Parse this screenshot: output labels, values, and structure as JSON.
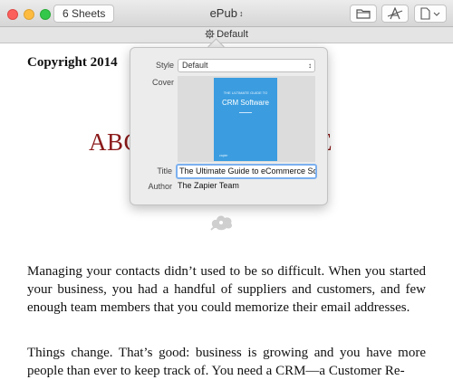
{
  "toolbar": {
    "sheets_label": "6 Sheets",
    "doc_title": "ePub",
    "title_chevron": "⌃⌄"
  },
  "sheetbar": {
    "label": "Default"
  },
  "document": {
    "copyright": "Copyright 2014",
    "chapter_left": "ABC",
    "chapter_right": "DE",
    "paragraph1": "Managing your contacts didn’t used to be so difficult. When you started your business, you had a handful of suppliers and customers, and few enough team members that you could memorize their email addresses.",
    "paragraph2": "Things change. That’s good: business is growing and you have more people than ever to keep track of. You need a CRM—a Customer Re-"
  },
  "popover": {
    "style_label": "Style",
    "style_value": "Default",
    "cover_label": "Cover",
    "title_label": "Title",
    "title_value": "The Ultimate Guide to eCommerce Software",
    "author_label": "Author",
    "author_value": "The Zapier Team",
    "cover_art": {
      "top_text": "THE ULTIMATE GUIDE TO",
      "main_text": "CRM Software",
      "foot_text": "zapier"
    }
  },
  "colors": {
    "chapter_title": "#8b1a1a",
    "cover_blue": "#3b9de0",
    "focus_ring": "#7cb0ef"
  },
  "icons": [
    "folder-icon",
    "font-icon",
    "document-icon",
    "gear-icon",
    "ornament-icon"
  ]
}
